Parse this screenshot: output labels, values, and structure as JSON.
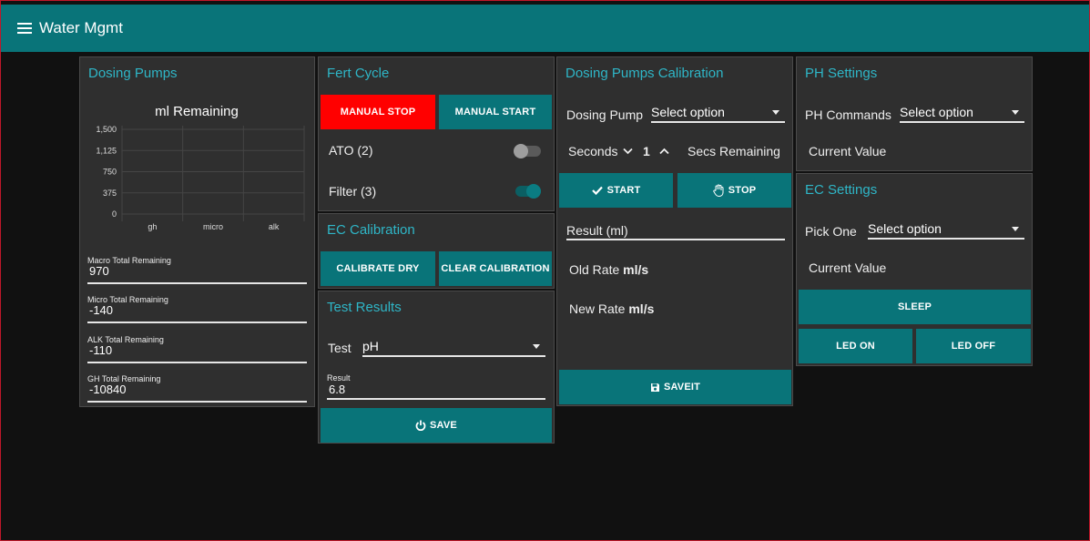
{
  "app": {
    "title": "Water Mgmt",
    "menu_icon": "hamburger-icon"
  },
  "dosing_pumps": {
    "title": "Dosing Pumps",
    "chart_title": "ml Remaining",
    "fields": [
      {
        "label": "Macro Total Remaining",
        "value": "970"
      },
      {
        "label": "Micro Total Remaining",
        "value": "-140"
      },
      {
        "label": "ALK Total Remaining",
        "value": "-110"
      },
      {
        "label": "GH Total Remaining",
        "value": "-10840"
      }
    ]
  },
  "chart_data": {
    "type": "bar",
    "title": "ml Remaining",
    "categories": [
      "gh",
      "micro",
      "alk"
    ],
    "yticks": [
      "0",
      "375",
      "750",
      "1,125",
      "1,500"
    ],
    "ylim": [
      0,
      1500
    ],
    "grid": true
  },
  "fert_cycle": {
    "title": "Fert Cycle",
    "manual_stop": "MANUAL STOP",
    "manual_start": "MANUAL START",
    "toggles": [
      {
        "label": "ATO (2)",
        "on": false
      },
      {
        "label": "Filter (3)",
        "on": true
      }
    ]
  },
  "ec_calibration": {
    "title": "EC Calibration",
    "calibrate_dry": "CALIBRATE DRY",
    "clear_calibration": "CLEAR CALIBRATION"
  },
  "test_results": {
    "title": "Test Results",
    "test_label": "Test",
    "test_value": "pH",
    "result_label": "Result",
    "result_value": "6.8",
    "save": "SAVE"
  },
  "calibration": {
    "title": "Dosing Pumps Calibration",
    "pump_label": "Dosing Pump",
    "pump_select": "Select option",
    "seconds_label": "Seconds",
    "seconds_value": "1",
    "secs_remaining": "Secs Remaining",
    "start": "START",
    "stop": "STOP",
    "result_label": "Result (ml)",
    "old_rate_label": "Old Rate",
    "old_rate_unit": "ml/s",
    "new_rate_label": "New Rate",
    "new_rate_unit": "ml/s",
    "saveit": "SAVEIT"
  },
  "ph_settings": {
    "title": "PH Settings",
    "commands_label": "PH Commands",
    "commands_select": "Select option",
    "current_value": "Current Value"
  },
  "ec_settings": {
    "title": "EC Settings",
    "pick_label": "Pick One",
    "pick_select": "Select option",
    "current_value": "Current Value",
    "sleep": "SLEEP",
    "led_on": "LED ON",
    "led_off": "LED OFF"
  },
  "colors": {
    "accent": "#097479",
    "title": "#2fb6c7",
    "stop": "#ff0000",
    "card": "#2f2f2f",
    "bg": "#111111"
  }
}
